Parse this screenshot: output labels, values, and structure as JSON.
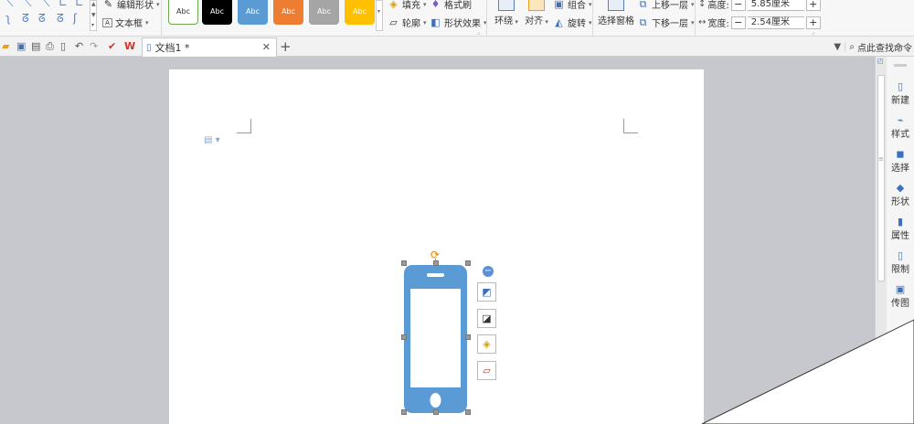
{
  "ribbon": {
    "connector_icons": [
      "connector-icon",
      "connector-icon",
      "connector-icon",
      "connector-icon",
      "connector-icon",
      "connector-icon",
      "connector-icon",
      "connector-icon",
      "connector-icon"
    ],
    "edit_shape": "编辑形状",
    "text_box": "文本框",
    "styles": [
      {
        "label": "Abc",
        "bg": "#ffffff",
        "fg": "#333333",
        "border": "#6aa84f"
      },
      {
        "label": "Abc",
        "bg": "#000000",
        "fg": "#ffffff",
        "border": "#000000"
      },
      {
        "label": "Abc",
        "bg": "#5b9bd5",
        "fg": "#ffffff",
        "border": "#5b9bd5"
      },
      {
        "label": "Abc",
        "bg": "#ed7d31",
        "fg": "#ffffff",
        "border": "#ed7d31"
      },
      {
        "label": "Abc",
        "bg": "#a5a5a5",
        "fg": "#ffffff",
        "border": "#a5a5a5"
      },
      {
        "label": "Abc",
        "bg": "#ffc000",
        "fg": "#ffffff",
        "border": "#ffc000"
      }
    ],
    "fill": "填充",
    "format_painter": "格式刷",
    "outline": "轮廓",
    "shape_effects": "形状效果",
    "wrap": "环绕",
    "align": "对齐",
    "group": "组合",
    "rotate": "旋转",
    "selection_pane": "选择窗格",
    "bring_forward": "上移一层",
    "send_backward": "下移一层",
    "height_label": "高度:",
    "height_value": "5.85厘米",
    "width_label": "宽度:",
    "width_value": "2.54厘米"
  },
  "quick_access": {
    "doc_tab_title": "文档1 *",
    "search_placeholder": "点此查找命令"
  },
  "side_panel": {
    "items": [
      "新建",
      "样式",
      "选择",
      "形状",
      "属性",
      "限制",
      "传图"
    ]
  },
  "colors": {
    "phone_blue": "#5b9bd5",
    "accent_orange": "#f39c12",
    "wps_red": "#d9302c"
  }
}
